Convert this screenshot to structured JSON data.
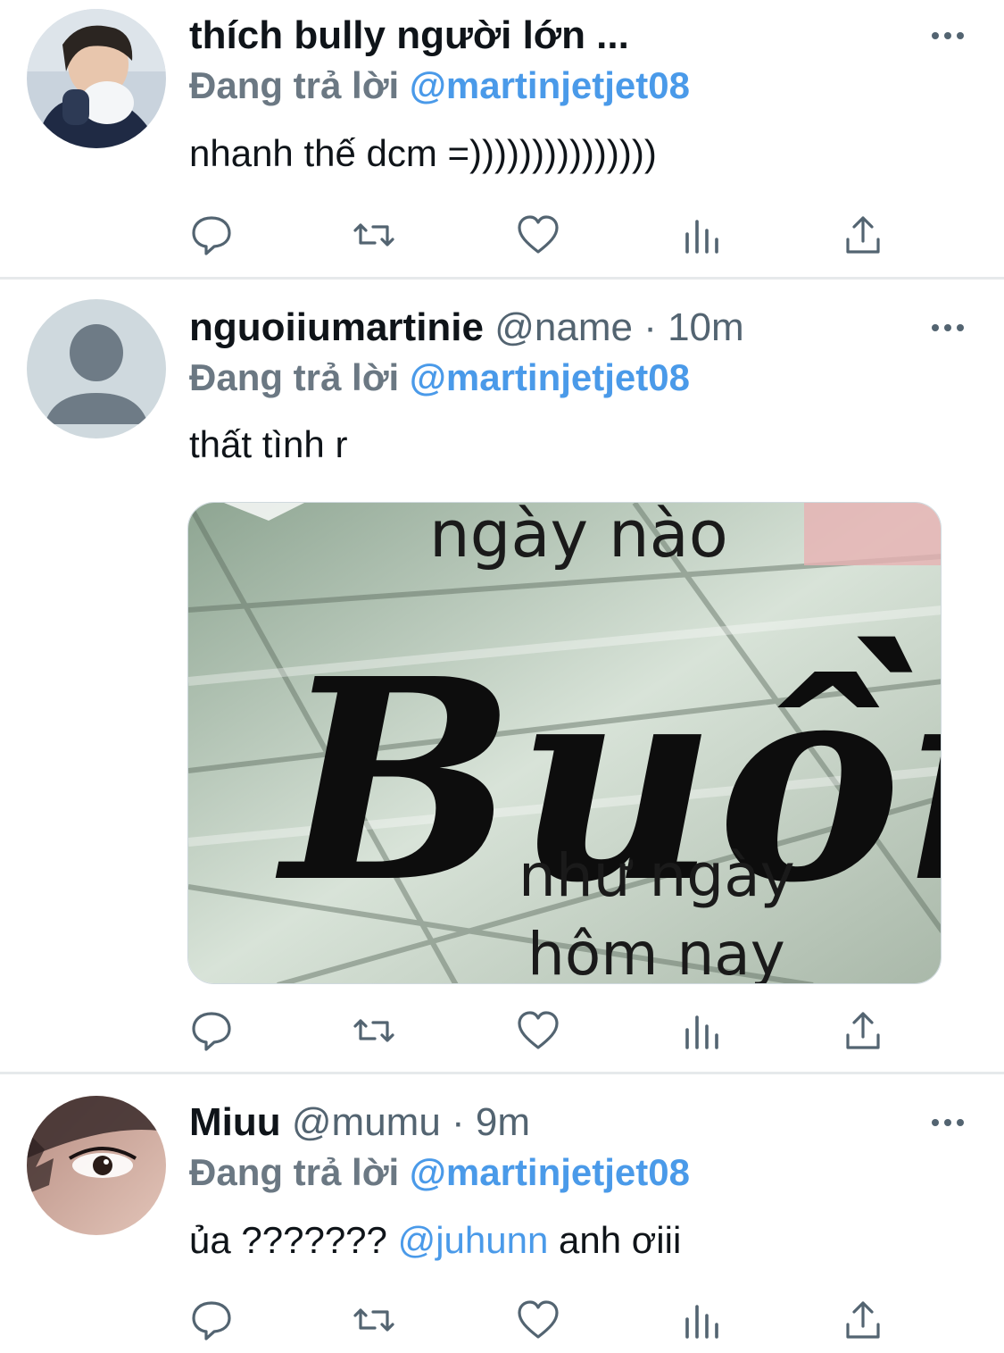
{
  "replying_prefix": "Đang trả lời",
  "colors": {
    "accent": "#4a9ae9",
    "muted": "#536471",
    "divider": "#e6e9eb"
  },
  "icons": [
    "reply-icon",
    "retweet-icon",
    "like-icon",
    "analytics-icon",
    "share-icon",
    "more-icon"
  ],
  "tweets": [
    {
      "display_name": "thích bully người lớn ...",
      "handle": "",
      "time": "",
      "replying_to": "@martinjetjet08",
      "text": "nhanh thế dcm =)))))))))))))))"
    },
    {
      "display_name": "nguoiiumartinie",
      "handle": "@name",
      "time": "· 10m",
      "replying_to": "@martinjetjet08",
      "text": "thất tình r",
      "image_text": {
        "line1": "ngày nào",
        "big": "Buồn",
        "line3": "như ngày",
        "line4": "hôm nay"
      }
    },
    {
      "display_name": "Miuu",
      "handle": "@mumu",
      "time": "· 9m",
      "replying_to": "@martinjetjet08",
      "text_before": "ủa ???????",
      "mention": "@juhunn",
      "text_after": "anh ơiii"
    }
  ]
}
